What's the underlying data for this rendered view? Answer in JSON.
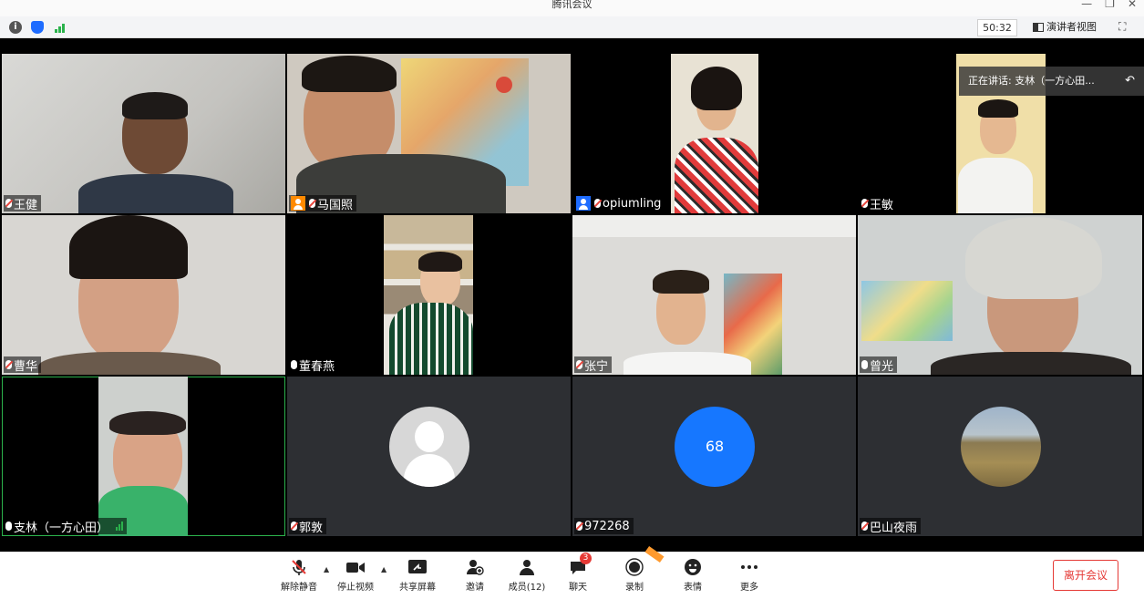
{
  "window": {
    "title": "腾讯会议",
    "controls": [
      "—",
      "❐",
      "✕"
    ]
  },
  "status_bar": {
    "timer": "50:32",
    "speaker_view_label": "演讲者视图",
    "fullscreen_icon": "⛶"
  },
  "speaking_banner": {
    "text": "正在讲话: 支林（一方心田...",
    "back_icon": "↶"
  },
  "tiles": [
    {
      "name": "王健"
    },
    {
      "name": "马国照"
    },
    {
      "name": "opiumling"
    },
    {
      "name": "王敏"
    },
    {
      "name": "曹华"
    },
    {
      "name": "董春燕"
    },
    {
      "name": "张宁"
    },
    {
      "name": "曾光"
    },
    {
      "name": "支林（一方心田）"
    },
    {
      "name": "郭敦"
    },
    {
      "name": "972268",
      "avatar_text": "68"
    },
    {
      "name": "巴山夜雨"
    }
  ],
  "toolbar": {
    "unmute": "解除静音",
    "stop_video": "停止视频",
    "share_screen": "共享屏幕",
    "invite": "邀请",
    "members": "成员(12)",
    "chat": "聊天",
    "chat_badge": "3",
    "record": "录制",
    "emoji": "表情",
    "more": "更多",
    "leave": "离开会议"
  },
  "colors": {
    "accent": "#1677ff",
    "leave": "#e53935",
    "signal": "#2bb24c",
    "host": "#ff8a00"
  }
}
